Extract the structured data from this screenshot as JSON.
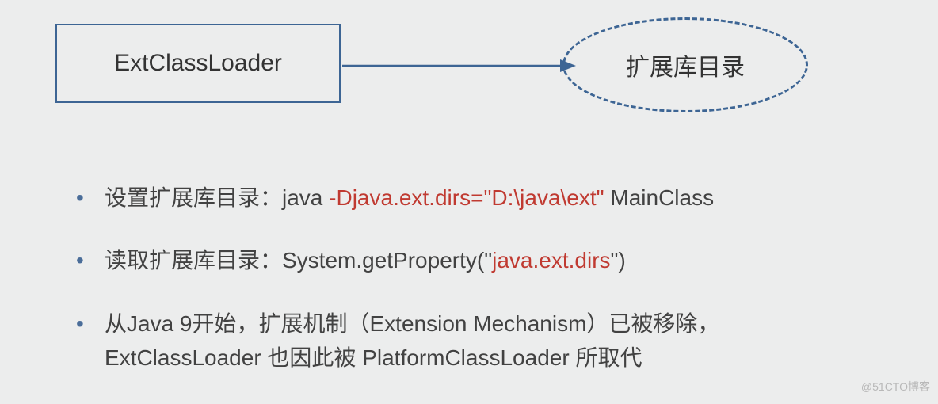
{
  "diagram": {
    "box_label": "ExtClassLoader",
    "ellipse_label": "扩展库目录"
  },
  "bullets": {
    "b1": {
      "prefix": "设置扩展库目录：java ",
      "red": "-Djava.ext.dirs=\"D:\\java\\ext\"",
      "suffix": " MainClass"
    },
    "b2": {
      "prefix": "读取扩展库目录：System.getProperty(\"",
      "red": "java.ext.dirs",
      "suffix": "\")"
    },
    "b3": {
      "line1": "从Java 9开始，扩展机制（Extension Mechanism）已被移除，",
      "line2": "ExtClassLoader 也因此被 PlatformClassLoader 所取代"
    }
  },
  "watermark": "@51CTO博客"
}
